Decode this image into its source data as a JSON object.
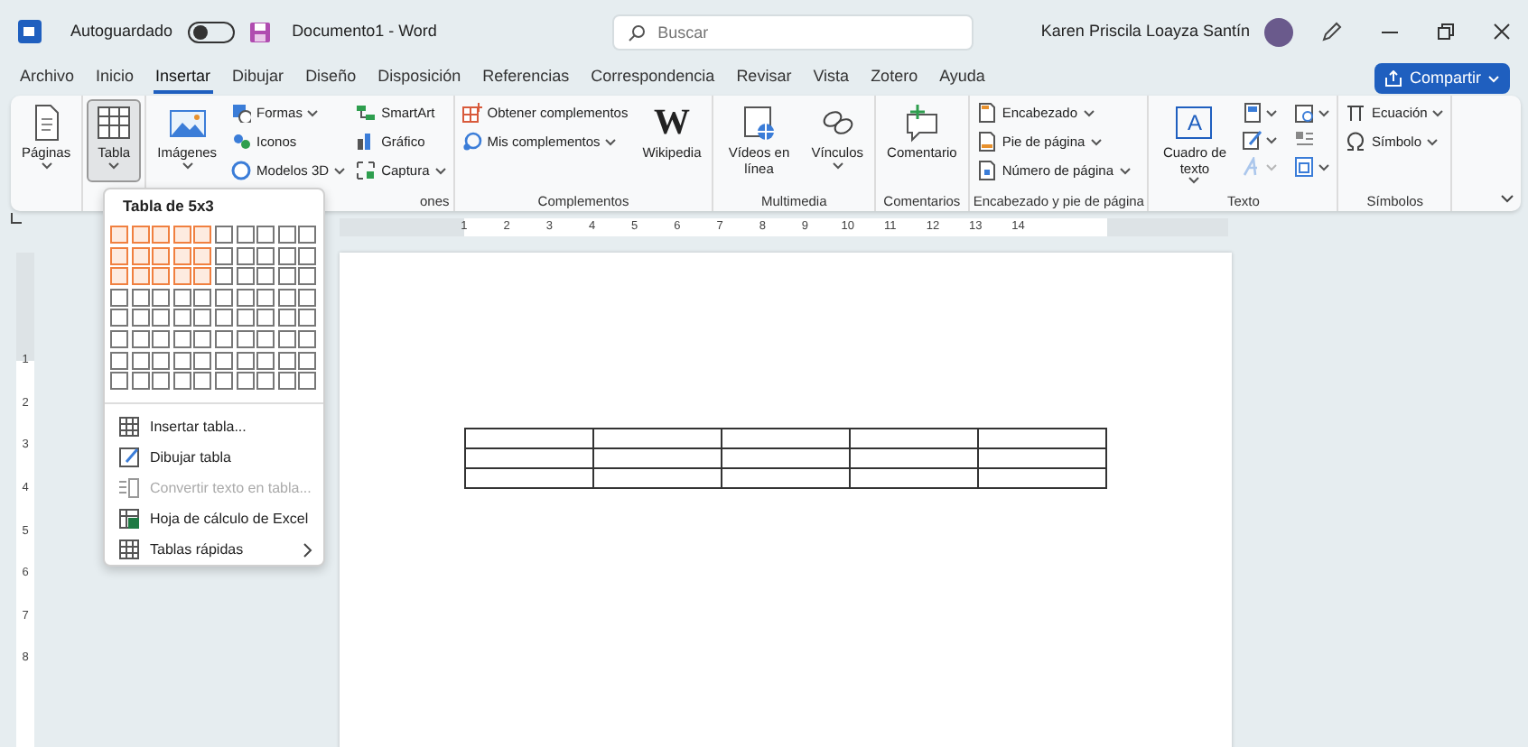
{
  "title_bar": {
    "autosave": {
      "label": "Autoguardado",
      "on": false
    },
    "document_title": "Documento1  -  Word",
    "search": {
      "placeholder": "Buscar"
    },
    "user_name": "Karen Priscila Loayza Santín"
  },
  "tabs": [
    {
      "label": "Archivo",
      "selected": false
    },
    {
      "label": "Inicio",
      "selected": false
    },
    {
      "label": "Insertar",
      "selected": true
    },
    {
      "label": "Dibujar",
      "selected": false
    },
    {
      "label": "Diseño",
      "selected": false
    },
    {
      "label": "Disposición",
      "selected": false
    },
    {
      "label": "Referencias",
      "selected": false
    },
    {
      "label": "Correspondencia",
      "selected": false
    },
    {
      "label": "Revisar",
      "selected": false
    },
    {
      "label": "Vista",
      "selected": false
    },
    {
      "label": "Zotero",
      "selected": false
    },
    {
      "label": "Ayuda",
      "selected": false
    }
  ],
  "share_button": {
    "label": "Compartir"
  },
  "ribbon": {
    "groups": [
      {
        "items": [
          {
            "kind": "large",
            "label": "Páginas",
            "caret": true,
            "pressed": false
          }
        ]
      },
      {
        "items": [
          {
            "kind": "large",
            "label": "Tabla",
            "caret": true,
            "pressed": true
          }
        ]
      },
      {
        "label": "ones",
        "items": [
          {
            "kind": "large",
            "label": "Imágenes",
            "caret": true,
            "pressed": false
          },
          {
            "kind": "stack",
            "entries": [
              {
                "label": "Formas",
                "caret": true
              },
              {
                "label": "Iconos",
                "caret": false
              },
              {
                "label": "Modelos 3D",
                "caret": true
              }
            ]
          },
          {
            "kind": "stack",
            "entries": [
              {
                "label": "SmartArt",
                "caret": false
              },
              {
                "label": "Gráfico",
                "caret": false
              },
              {
                "label": "Captura",
                "caret": true
              }
            ]
          }
        ]
      },
      {
        "label": "Complementos",
        "items": [
          {
            "kind": "stack",
            "entries": [
              {
                "label": "Obtener complementos",
                "caret": false
              },
              {
                "label": "Mis complementos",
                "caret": true
              }
            ]
          },
          {
            "kind": "large",
            "label": "Wikipedia",
            "icon_text": "W",
            "caret": false,
            "pressed": false
          }
        ]
      },
      {
        "label": "Multimedia",
        "items": [
          {
            "kind": "large",
            "label": "Vídeos en línea",
            "caret": false,
            "pressed": false
          },
          {
            "kind": "large",
            "label": "Vínculos",
            "caret": true,
            "pressed": false
          }
        ]
      },
      {
        "label": "Comentarios",
        "items": [
          {
            "kind": "large",
            "label": "Comentario",
            "caret": false,
            "pressed": false
          }
        ]
      },
      {
        "label": "Encabezado y pie de página",
        "items": [
          {
            "kind": "stack",
            "entries": [
              {
                "label": "Encabezado",
                "caret": true
              },
              {
                "label": "Pie de página",
                "caret": true
              },
              {
                "label": "Número de página",
                "caret": true
              }
            ]
          }
        ]
      },
      {
        "label": "Texto",
        "items": [
          {
            "kind": "large",
            "label": "Cuadro de texto",
            "icon_text": "A",
            "caret": true,
            "pressed": false
          },
          {
            "kind": "icon_grid",
            "entries": [
              {
                "caret": true,
                "disabled": false
              },
              {
                "caret": true,
                "disabled": false
              },
              {
                "caret": true,
                "disabled": true
              },
              {
                "caret": true,
                "disabled": false
              },
              {
                "caret": false,
                "disabled": false
              },
              {
                "caret": true,
                "disabled": false
              }
            ]
          }
        ]
      },
      {
        "label": "Símbolos",
        "items": [
          {
            "kind": "stack",
            "entries": [
              {
                "label": "Ecuación",
                "caret": true
              },
              {
                "label": "Símbolo",
                "caret": true
              }
            ]
          }
        ]
      }
    ]
  },
  "ruler": {
    "horizontal": [
      "1",
      "2",
      "3",
      "4",
      "5",
      "6",
      "7",
      "8",
      "9",
      "10",
      "11",
      "12",
      "13",
      "14"
    ],
    "vertical": [
      "1",
      "2",
      "3",
      "4",
      "5",
      "6",
      "7",
      "8"
    ]
  },
  "document_table": {
    "rows": [
      {
        "cells": [
          {
            "kind": "empty"
          },
          {
            "kind": "empty"
          },
          {
            "kind": "empty"
          },
          {
            "kind": "empty"
          },
          {
            "kind": "empty"
          }
        ]
      },
      {
        "cells": [
          {
            "kind": "empty"
          },
          {
            "kind": "empty"
          },
          {
            "kind": "empty"
          },
          {
            "kind": "empty"
          },
          {
            "kind": "empty"
          }
        ]
      },
      {
        "cells": [
          {
            "kind": "empty"
          },
          {
            "kind": "empty"
          },
          {
            "kind": "empty"
          },
          {
            "kind": "empty"
          },
          {
            "kind": "empty"
          }
        ]
      }
    ]
  },
  "table_menu": {
    "title": "Tabla de 5x3",
    "grid": {
      "rows": [
        {
          "cells": [
            {
              "selected": true
            },
            {
              "selected": true
            },
            {
              "selected": true
            },
            {
              "selected": true
            },
            {
              "selected": true
            },
            {
              "selected": false
            },
            {
              "selected": false
            },
            {
              "selected": false
            },
            {
              "selected": false
            },
            {
              "selected": false
            }
          ]
        },
        {
          "cells": [
            {
              "selected": true
            },
            {
              "selected": true
            },
            {
              "selected": true
            },
            {
              "selected": true
            },
            {
              "selected": true
            },
            {
              "selected": false
            },
            {
              "selected": false
            },
            {
              "selected": false
            },
            {
              "selected": false
            },
            {
              "selected": false
            }
          ]
        },
        {
          "cells": [
            {
              "selected": true
            },
            {
              "selected": true
            },
            {
              "selected": true
            },
            {
              "selected": true
            },
            {
              "selected": true
            },
            {
              "selected": false
            },
            {
              "selected": false
            },
            {
              "selected": false
            },
            {
              "selected": false
            },
            {
              "selected": false
            }
          ]
        },
        {
          "cells": [
            {
              "selected": false
            },
            {
              "selected": false
            },
            {
              "selected": false
            },
            {
              "selected": false
            },
            {
              "selected": false
            },
            {
              "selected": false
            },
            {
              "selected": false
            },
            {
              "selected": false
            },
            {
              "selected": false
            },
            {
              "selected": false
            }
          ]
        },
        {
          "cells": [
            {
              "selected": false
            },
            {
              "selected": false
            },
            {
              "selected": false
            },
            {
              "selected": false
            },
            {
              "selected": false
            },
            {
              "selected": false
            },
            {
              "selected": false
            },
            {
              "selected": false
            },
            {
              "selected": false
            },
            {
              "selected": false
            }
          ]
        },
        {
          "cells": [
            {
              "selected": false
            },
            {
              "selected": false
            },
            {
              "selected": false
            },
            {
              "selected": false
            },
            {
              "selected": false
            },
            {
              "selected": false
            },
            {
              "selected": false
            },
            {
              "selected": false
            },
            {
              "selected": false
            },
            {
              "selected": false
            }
          ]
        },
        {
          "cells": [
            {
              "selected": false
            },
            {
              "selected": false
            },
            {
              "selected": false
            },
            {
              "selected": false
            },
            {
              "selected": false
            },
            {
              "selected": false
            },
            {
              "selected": false
            },
            {
              "selected": false
            },
            {
              "selected": false
            },
            {
              "selected": false
            }
          ]
        },
        {
          "cells": [
            {
              "selected": false
            },
            {
              "selected": false
            },
            {
              "selected": false
            },
            {
              "selected": false
            },
            {
              "selected": false
            },
            {
              "selected": false
            },
            {
              "selected": false
            },
            {
              "selected": false
            },
            {
              "selected": false
            },
            {
              "selected": false
            }
          ]
        }
      ]
    },
    "items": [
      {
        "label": "Insertar tabla...",
        "disabled": false,
        "submenu": false
      },
      {
        "label": "Dibujar tabla",
        "disabled": false,
        "submenu": false
      },
      {
        "label": "Convertir texto en tabla...",
        "disabled": true,
        "submenu": false
      },
      {
        "label": "Hoja de cálculo de Excel",
        "disabled": false,
        "submenu": false
      },
      {
        "label": "Tablas rápidas",
        "disabled": false,
        "submenu": true
      }
    ]
  }
}
